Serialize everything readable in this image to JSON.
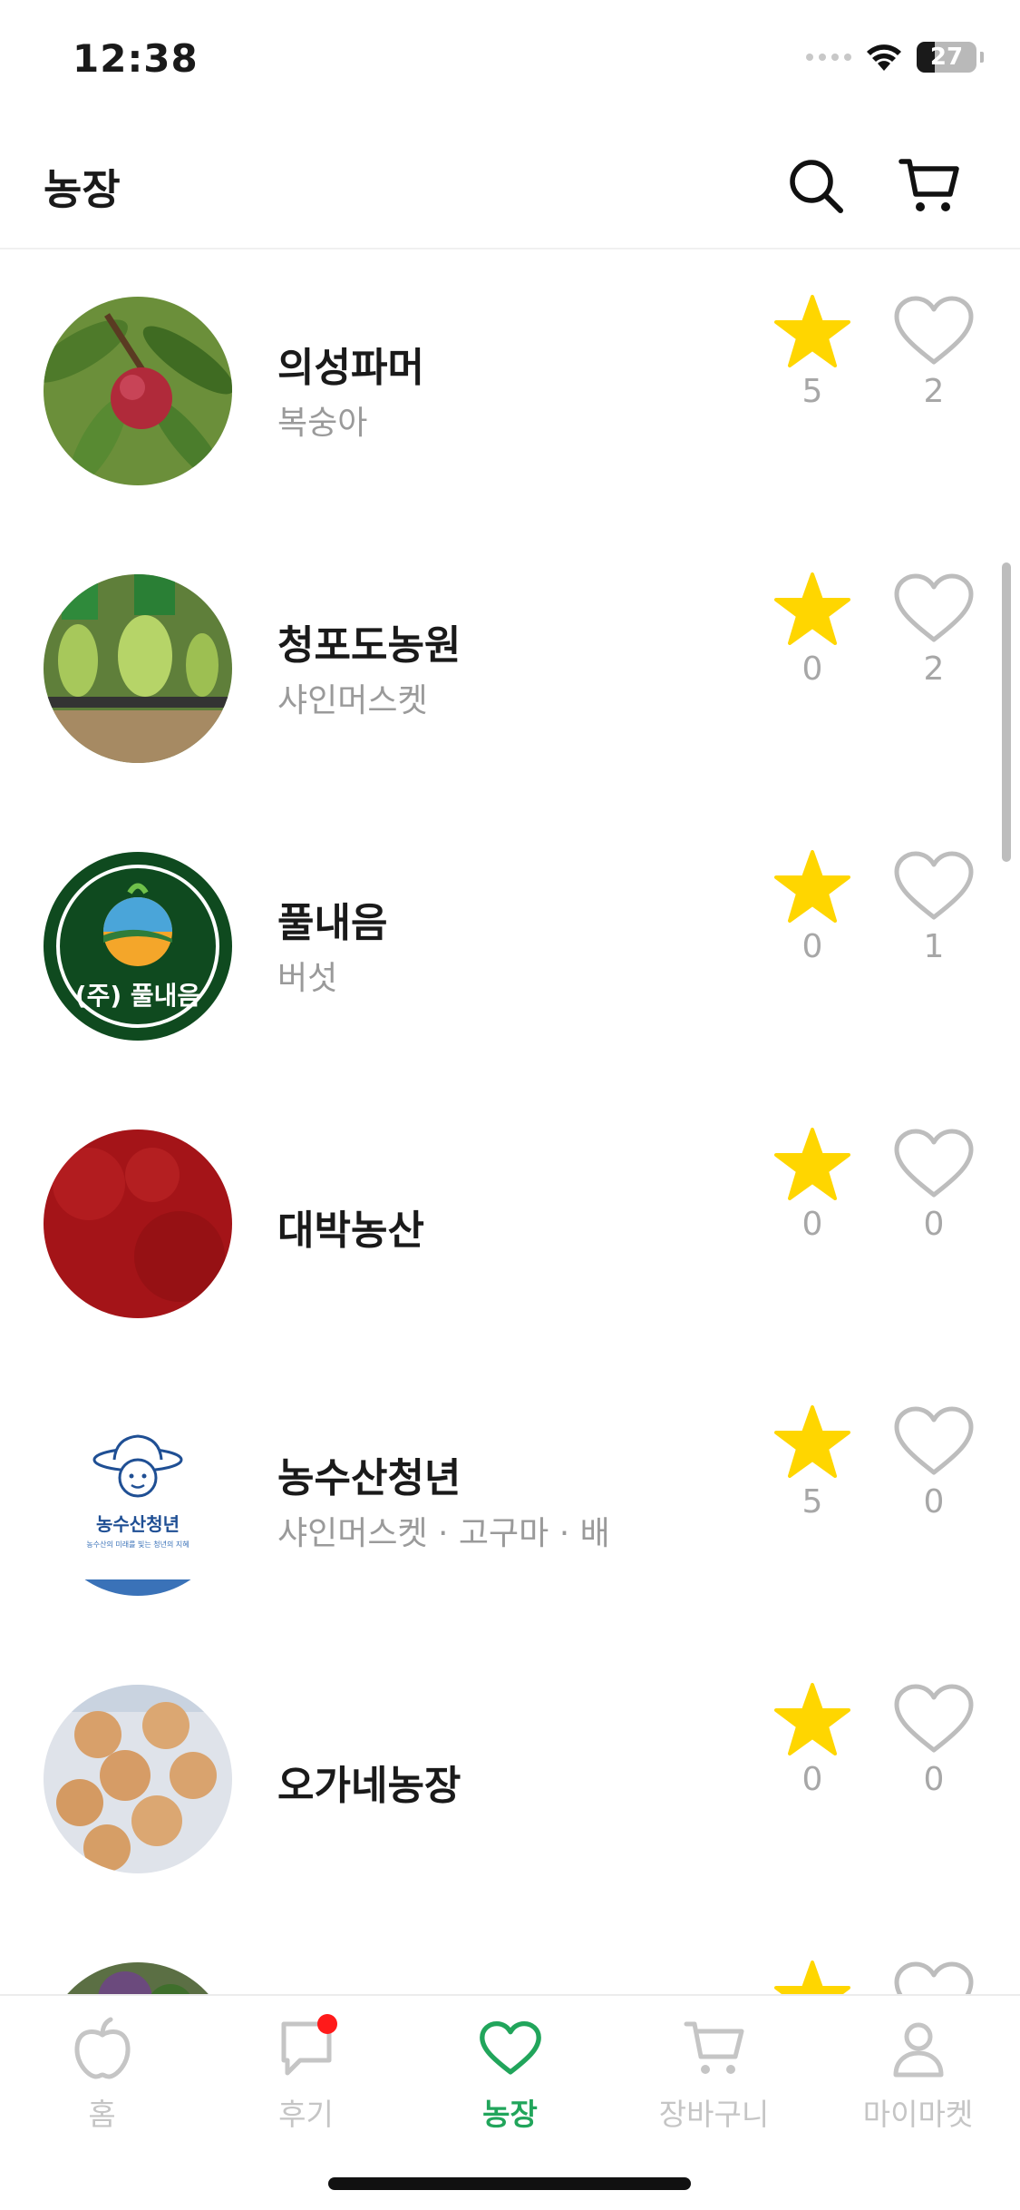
{
  "status_bar": {
    "time": "12:38",
    "battery": "27"
  },
  "header": {
    "title": "농장",
    "search_icon": "search-icon",
    "cart_icon": "cart-icon"
  },
  "colors": {
    "star": "#FFD600",
    "accent": "#21A55B",
    "muted": "#A7A7A7",
    "badge": "#FF1A1A"
  },
  "farms": [
    {
      "name": "의성파머",
      "products": "복숭아",
      "stars": "5",
      "likes": "2"
    },
    {
      "name": "청포도농원",
      "products": "샤인머스켓",
      "stars": "0",
      "likes": "2"
    },
    {
      "name": "풀내음",
      "products": "버섯",
      "stars": "0",
      "likes": "1"
    },
    {
      "name": "대박농산",
      "products": "",
      "stars": "0",
      "likes": "0"
    },
    {
      "name": "농수산청년",
      "products": "샤인머스켓 · 고구마 · 배",
      "stars": "5",
      "likes": "0"
    },
    {
      "name": "오가네농장",
      "products": "",
      "stars": "0",
      "likes": "0"
    }
  ],
  "logos": {
    "pulnaeum": "(주) 풀내음",
    "nongsusan": "농수산청년",
    "nongsusan_tagline": "농수산의 미래를 빛는 청년의 지혜"
  },
  "nav": {
    "items": [
      {
        "label": "홈",
        "icon": "apple-icon"
      },
      {
        "label": "후기",
        "icon": "chat-icon"
      },
      {
        "label": "농장",
        "icon": "heart-icon"
      },
      {
        "label": "장바구니",
        "icon": "cart-icon"
      },
      {
        "label": "마이마켓",
        "icon": "user-icon"
      }
    ],
    "active": "농장"
  }
}
